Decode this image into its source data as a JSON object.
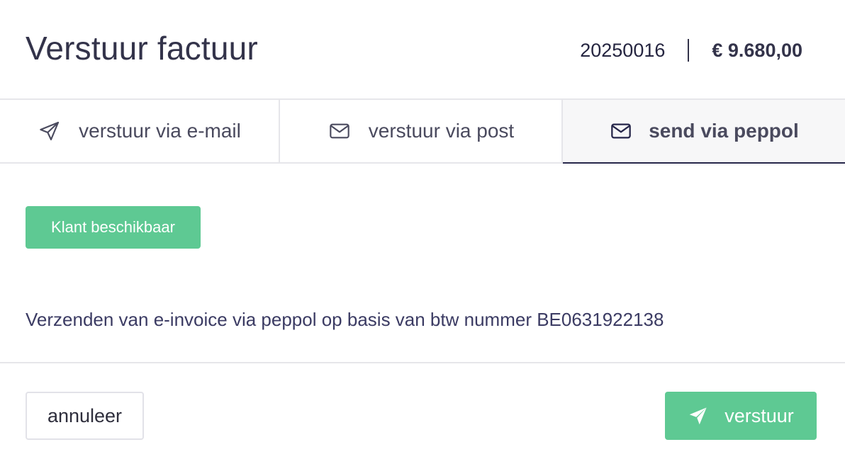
{
  "header": {
    "title": "Verstuur factuur",
    "invoice_number": "20250016",
    "amount": "€ 9.680,00"
  },
  "tabs": [
    {
      "label": "verstuur via e-mail",
      "icon": "paper-plane-icon",
      "active": false
    },
    {
      "label": "verstuur via post",
      "icon": "envelope-icon",
      "active": false
    },
    {
      "label": "send via peppol",
      "icon": "envelope-icon",
      "active": true
    }
  ],
  "status": {
    "badge": "Klant beschikbaar",
    "badge_color": "#5ec993"
  },
  "description": "Verzenden van e-invoice via peppol op basis van btw nummer BE0631922138",
  "footer": {
    "cancel_label": "annuleer",
    "send_label": "verstuur",
    "send_icon": "paper-plane-icon"
  },
  "colors": {
    "accent": "#5ec993",
    "text_dark": "#33334a",
    "active_tab_underline": "#26264a"
  }
}
